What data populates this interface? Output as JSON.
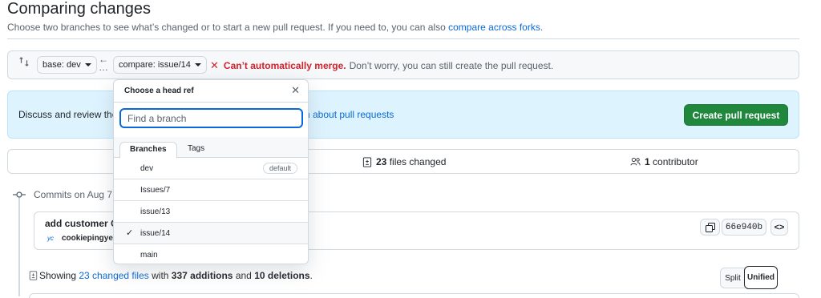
{
  "header": {
    "title": "Comparing changes",
    "subtitle_prefix": "Choose two branches to see what’s changed or to start a new pull request. If you need to, you can also ",
    "subtitle_link": "compare across forks",
    "subtitle_suffix": "."
  },
  "range": {
    "base_label": "base: dev",
    "compare_label": "compare: issue/14",
    "merge_error": "Can’t automatically merge.",
    "merge_message": "Don’t worry, you can still create the pull request."
  },
  "discuss": {
    "text": "Discuss and review the",
    "learn_link": "n about pull requests",
    "create_button": "Create pull request"
  },
  "stats": {
    "files_count": "23",
    "files_label": "files changed",
    "contributors_count": "1",
    "contributors_label": "contributor"
  },
  "commits": {
    "date_heading": "Commits on Aug 7,",
    "title": "add customer C",
    "author": "cookiepingye",
    "sha": "66e940b"
  },
  "summary": {
    "prefix": "Showing ",
    "files_link": "23 changed files",
    "middle": " with ",
    "additions": "337 additions",
    "and": " and ",
    "deletions": "10 deletions",
    "end": ".",
    "split_label": "Split",
    "unified_label": "Unified"
  },
  "dropdown": {
    "title": "Choose a head ref",
    "filter_placeholder": "Find a branch",
    "tabs": [
      "Branches",
      "Tags"
    ],
    "items": [
      {
        "name": "dev",
        "badge": "default",
        "selected": false
      },
      {
        "name": "Issues/7",
        "badge": "",
        "selected": false
      },
      {
        "name": "issue/13",
        "badge": "",
        "selected": false
      },
      {
        "name": "issue/14",
        "badge": "",
        "selected": true
      },
      {
        "name": "main",
        "badge": "",
        "selected": false
      }
    ]
  },
  "colors": {
    "accent": "#0969da",
    "danger": "#d1242f",
    "primary_button": "#1f883d",
    "info_bg": "#ddf4ff"
  },
  "icons": {
    "compare": "git-compare-icon",
    "arrow": "arrow-left-icon",
    "merge_status": "x-icon",
    "files": "file-diff-icon",
    "contributors": "people-icon",
    "commit": "git-commit-icon",
    "copy": "copy-icon",
    "browse": "code-icon",
    "check": "check-icon",
    "close": "x-icon"
  }
}
